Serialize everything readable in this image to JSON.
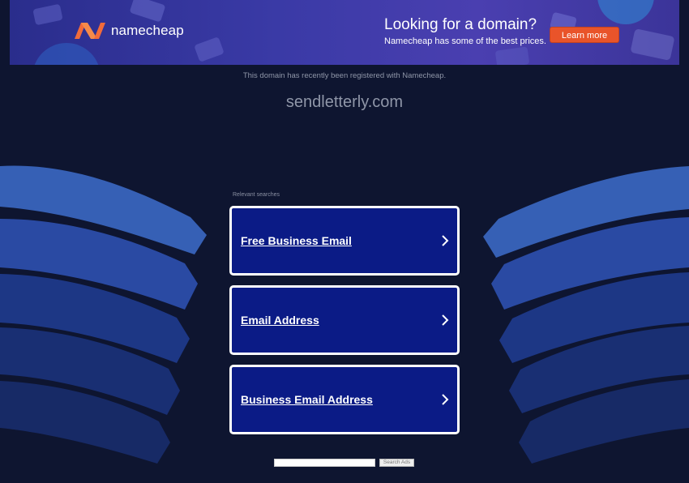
{
  "banner": {
    "logo_text": "namecheap",
    "headline": "Looking for a domain?",
    "subtext": "Namecheap has some of the best prices.",
    "cta_label": "Learn more",
    "brand_color": "#e9542a"
  },
  "domain": {
    "registered_note": "This domain has recently been registered with Namecheap.",
    "name": "sendletterly.com"
  },
  "searches": {
    "label": "Relevant searches",
    "items": [
      {
        "label": "Free Business Email"
      },
      {
        "label": "Email Address"
      },
      {
        "label": "Business Email Address"
      }
    ]
  },
  "search_form": {
    "input_value": "",
    "button_label": "Search Ads"
  },
  "colors": {
    "background": "#0e1530",
    "link_box": "#0b1b86",
    "wave_light": "#3a5fb8",
    "wave_dark": "#16286b"
  }
}
